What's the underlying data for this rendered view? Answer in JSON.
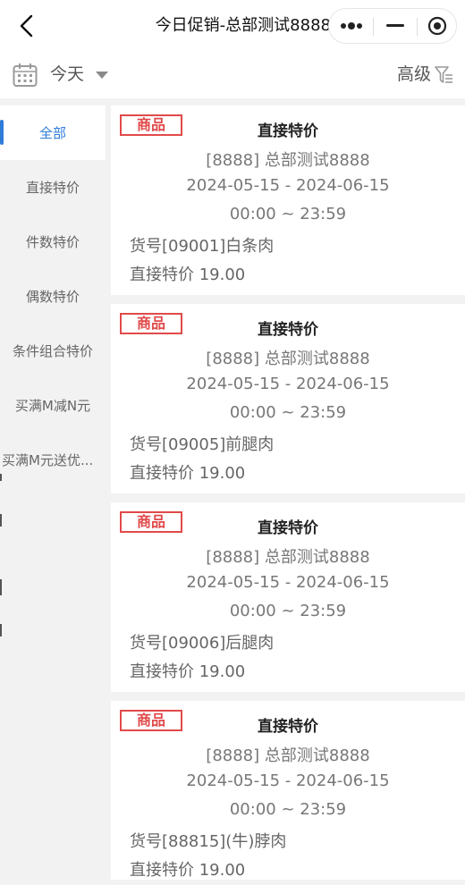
{
  "header": {
    "title": "今日促销-总部测试8888"
  },
  "filter": {
    "date_label": "今天",
    "advanced_label": "高级"
  },
  "sidebar": {
    "items": [
      {
        "label": "全部",
        "active": true
      },
      {
        "label": "直接特价"
      },
      {
        "label": "件数特价"
      },
      {
        "label": "偶数特价"
      },
      {
        "label": "条件组合特价"
      },
      {
        "label": "买满M减N元"
      },
      {
        "label": "买满M元送优..."
      }
    ]
  },
  "cards": [
    {
      "tag": "商品",
      "type": "直接特价",
      "store": "[8888] 总部测试8888",
      "date_range": "2024-05-15 - 2024-06-15",
      "time_range": "00:00 ~ 23:59",
      "item": "货号[09001]白条肉",
      "price": "直接特价 19.00"
    },
    {
      "tag": "商品",
      "type": "直接特价",
      "store": "[8888] 总部测试8888",
      "date_range": "2024-05-15 - 2024-06-15",
      "time_range": "00:00 ~ 23:59",
      "item": "货号[09005]前腿肉",
      "price": "直接特价 19.00"
    },
    {
      "tag": "商品",
      "type": "直接特价",
      "store": "[8888] 总部测试8888",
      "date_range": "2024-05-15 - 2024-06-15",
      "time_range": "00:00 ~ 23:59",
      "item": "货号[09006]后腿肉",
      "price": "直接特价 19.00"
    },
    {
      "tag": "商品",
      "type": "直接特价",
      "store": "[8888] 总部测试8888",
      "date_range": "2024-05-15 - 2024-06-15",
      "time_range": "00:00 ~ 23:59",
      "item": "货号[88815](牛)脖肉",
      "price": "直接特价 19.00"
    }
  ],
  "icons": {
    "back": "chevron-left-icon",
    "more": "more-dots-icon",
    "minimize": "minimize-icon",
    "close": "target-close-icon",
    "calendar": "calendar-icon",
    "dropdown": "caret-down-icon",
    "filter": "filter-funnel-icon"
  },
  "colors": {
    "accent": "#2f7cd8",
    "tag": "#e14a4a",
    "background": "#f2f2f2"
  }
}
